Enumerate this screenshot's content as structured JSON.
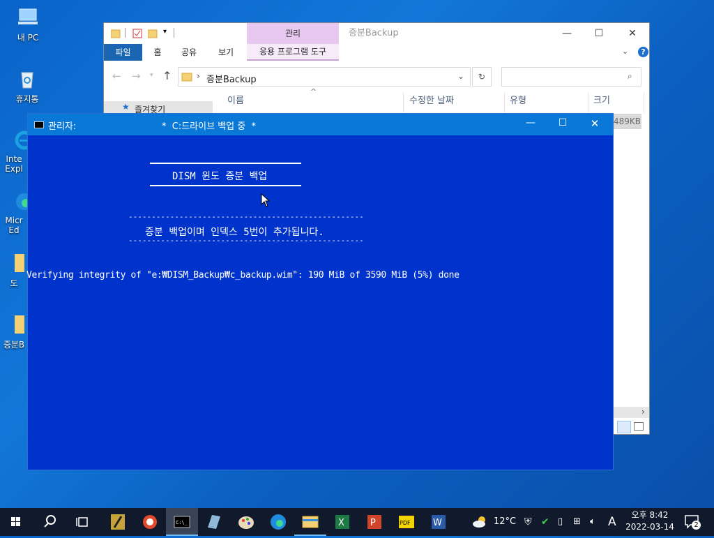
{
  "desktop": {
    "icons": [
      {
        "label": "내 PC"
      },
      {
        "label": "휴지통"
      },
      {
        "label": "Inte Expl"
      },
      {
        "label": "Micr Ed"
      },
      {
        "label": "도"
      },
      {
        "label": "증분B"
      }
    ]
  },
  "explorer": {
    "title": "증분Backup",
    "context_tab_top": "관리",
    "context_tab": "응용 프로그램 도구",
    "ribbon_tabs": [
      "파일",
      "홈",
      "공유",
      "보기"
    ],
    "address": "증분Backup",
    "nav_item": "즐겨찾기",
    "columns": [
      "이름",
      "수정한 날짜",
      "유형",
      "크기"
    ],
    "file_size": "489KB",
    "window_buttons": {
      "minimize": "—",
      "maximize": "☐",
      "close": "✕"
    }
  },
  "cmd": {
    "title_left": "관리자:",
    "title_main": "*  C:드라이브 백업 중  *",
    "heading": "DISM 윈도 증분 백업",
    "dashes": "---------------------------------------------------",
    "notice": "증분 백업이며 인덱스 5번이 추가됩니다.",
    "progress_line": "Verifying integrity of \"e:₩DISM_Backup₩c_backup.wim\": 190 MiB of 3590 MiB (5%) done"
  },
  "taskbar": {
    "weather": "12°C",
    "ime": "A",
    "time": "오후 8:42",
    "date": "2022-03-14",
    "notification_count": "2"
  },
  "colors": {
    "cmd_bg": "#0033cc",
    "cmd_title": "#0a78d7",
    "explorer_file_tab": "#1a66b3",
    "context_tab": "#e8c7f0",
    "taskbar": "#101a2c"
  }
}
